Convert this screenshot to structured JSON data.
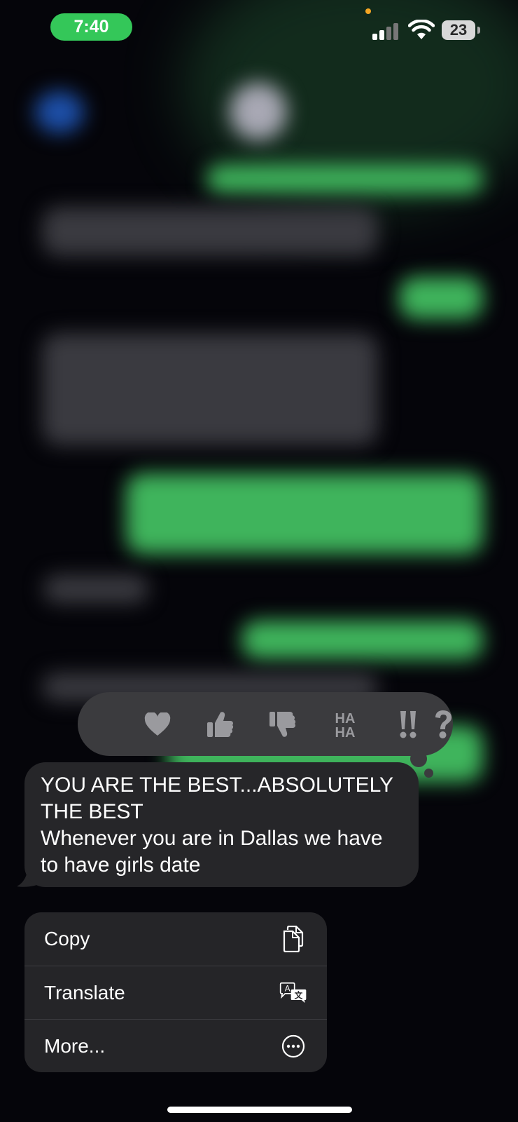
{
  "status_bar": {
    "time": "7:40",
    "battery_level": "23",
    "signal_icon": "cellular-signal-icon",
    "wifi_icon": "wifi-icon",
    "accent": "#34c759"
  },
  "tapback": {
    "reactions": [
      {
        "name": "heart-icon",
        "label": "Heart"
      },
      {
        "name": "thumbs-up-icon",
        "label": "Like"
      },
      {
        "name": "thumbs-down-icon",
        "label": "Dislike"
      },
      {
        "name": "haha-icon",
        "label": "HA HA"
      },
      {
        "name": "exclamation-icon",
        "label": "‼"
      },
      {
        "name": "question-icon",
        "label": "?"
      }
    ]
  },
  "message": {
    "text": "YOU ARE THE BEST...ABSOLUTELY THE BEST\nWhenever you are in Dallas we have to have girls date"
  },
  "context_menu": {
    "items": [
      {
        "label": "Copy",
        "icon": "copy-icon"
      },
      {
        "label": "Translate",
        "icon": "translate-icon"
      },
      {
        "label": "More...",
        "icon": "more-icon"
      }
    ]
  }
}
